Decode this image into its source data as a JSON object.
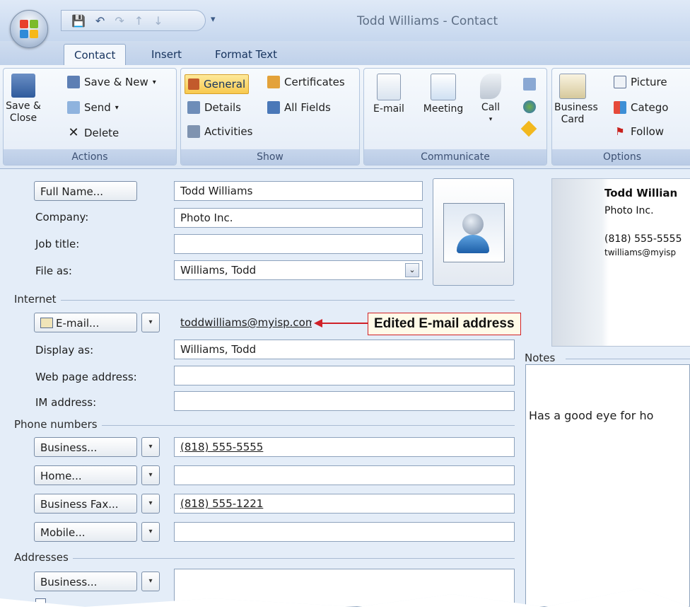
{
  "window": {
    "title": "Todd Williams - Contact"
  },
  "colors": {
    "accent_red": "#d02128",
    "callout_bg": "#fffbe8",
    "ribbon_highlight": "#f8c94e"
  },
  "tabs": [
    "Contact",
    "Insert",
    "Format Text"
  ],
  "ribbon": {
    "actions": {
      "save_close": "Save & Close",
      "save_new": "Save & New",
      "send": "Send",
      "delete": "Delete",
      "label": "Actions"
    },
    "show": {
      "general": "General",
      "certificates": "Certificates",
      "details": "Details",
      "all_fields": "All Fields",
      "activities": "Activities",
      "label": "Show"
    },
    "communicate": {
      "email": "E-mail",
      "meeting": "Meeting",
      "call": "Call",
      "label": "Communicate"
    },
    "options": {
      "business_card": "Business Card",
      "picture": "Picture",
      "categorize": "Catego",
      "follow": "Follow",
      "label": "Options"
    }
  },
  "form": {
    "full_name_btn": "Full Name...",
    "full_name": "Todd Williams",
    "company_label": "Company:",
    "company": "Photo Inc.",
    "job_title_label": "Job title:",
    "job_title": "",
    "file_as_label": "File as:",
    "file_as": "Williams, Todd",
    "internet_section": "Internet",
    "email_btn": "E-mail...",
    "email": "toddwilliams@myisp.com",
    "display_as_label": "Display as:",
    "display_as": "Williams, Todd",
    "web_label": "Web page address:",
    "web": "",
    "im_label": "IM address:",
    "im": "",
    "phone_section": "Phone numbers",
    "phones": [
      {
        "btn": "Business...",
        "value": "(818) 555-5555"
      },
      {
        "btn": "Home...",
        "value": ""
      },
      {
        "btn": "Business Fax...",
        "value": "(818) 555-1221"
      },
      {
        "btn": "Mobile...",
        "value": ""
      }
    ],
    "addresses_section": "Addresses",
    "address_btn": "Business...",
    "address": ""
  },
  "business_card": {
    "name": "Todd Willian",
    "company": "Photo Inc.",
    "phone": "(818) 555-5555",
    "email": "twilliams@myisp"
  },
  "notes": {
    "label": "Notes",
    "text": "Has a good eye for ho"
  },
  "callout": "Edited E-mail address"
}
